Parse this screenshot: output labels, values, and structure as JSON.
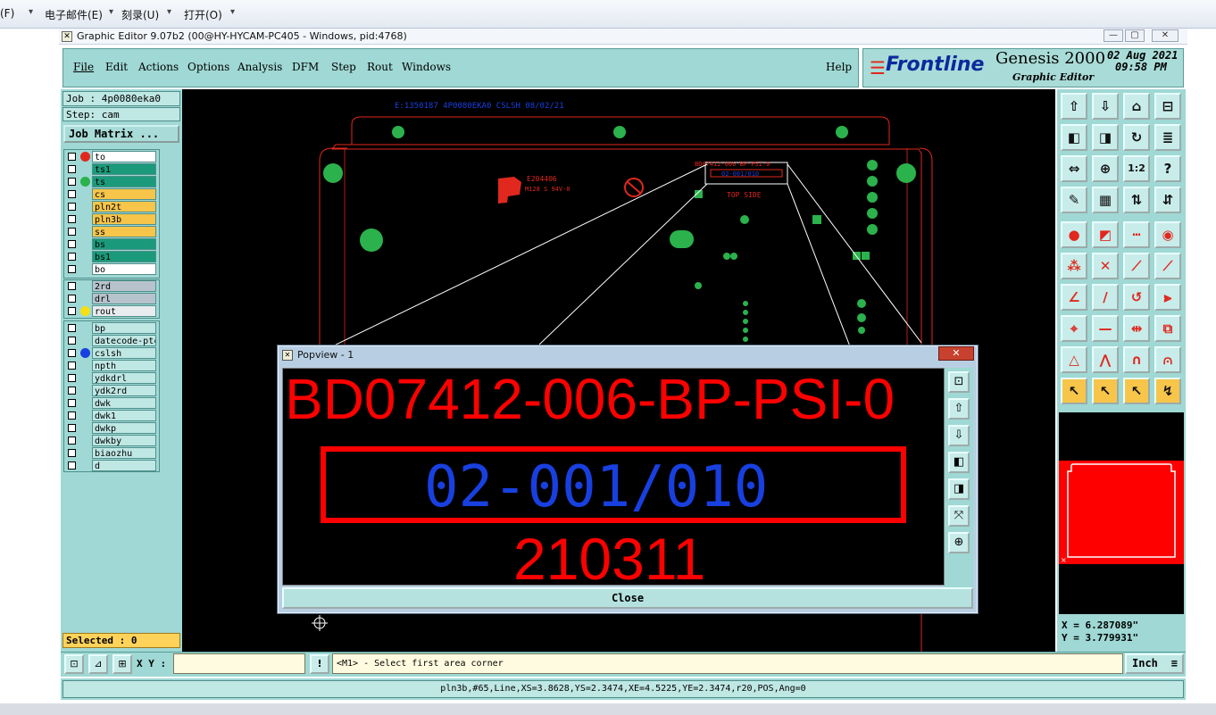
{
  "host_menu": {
    "items": [
      "(F)",
      "电子邮件(E)",
      "刻录(U)",
      "打开(O)"
    ]
  },
  "window": {
    "title": "Graphic Editor 9.07b2 (00@HY-HYCAM-PC405 - Windows, pid:4768)"
  },
  "menubar": {
    "items": [
      "File",
      "Edit",
      "Actions",
      "Options",
      "Analysis",
      "DFM",
      "Step",
      "Rout",
      "Windows"
    ],
    "help": "Help"
  },
  "brand": {
    "frontline": "Frontline",
    "product": "Genesis 2000",
    "subtitle": "Graphic Editor",
    "date": "02 Aug 2021",
    "time": "09:58 PM"
  },
  "left_panel": {
    "job": "Job : 4p0080eka0",
    "step": "Step: cam",
    "job_matrix": "Job Matrix ...",
    "layers_group1": [
      {
        "name": "to",
        "bg": "#ffffff",
        "dot": "#e0281e"
      },
      {
        "name": "ts1",
        "bg": "#1a9a7a",
        "dot": ""
      },
      {
        "name": "ts",
        "bg": "#1a9a7a",
        "dot": "#2bb24c"
      },
      {
        "name": "cs",
        "bg": "#f6c54a",
        "dot": ""
      },
      {
        "name": "pln2t",
        "bg": "#f6c54a",
        "dot": ""
      },
      {
        "name": "pln3b",
        "bg": "#f6c54a",
        "dot": ""
      },
      {
        "name": "ss",
        "bg": "#f6c54a",
        "dot": ""
      },
      {
        "name": "bs",
        "bg": "#1a9a7a",
        "dot": ""
      },
      {
        "name": "bs1",
        "bg": "#1a9a7a",
        "dot": ""
      },
      {
        "name": "bo",
        "bg": "#ffffff",
        "dot": ""
      }
    ],
    "layers_group2": [
      {
        "name": "2rd",
        "bg": "#b7c3cc",
        "dot": ""
      },
      {
        "name": "drl",
        "bg": "#b7c3cc",
        "dot": ""
      },
      {
        "name": "rout",
        "bg": "#e8ecef",
        "dot": "#f5e016"
      }
    ],
    "layers_group3": [
      {
        "name": "bp",
        "bg": "#bfe7e4",
        "dot": ""
      },
      {
        "name": "datecode-ptc",
        "bg": "#bfe7e4",
        "dot": ""
      },
      {
        "name": "cslsh",
        "bg": "#bfe7e4",
        "dot": "#1840e0"
      },
      {
        "name": "npth",
        "bg": "#bfe7e4",
        "dot": ""
      },
      {
        "name": "ydkdrl",
        "bg": "#bfe7e4",
        "dot": ""
      },
      {
        "name": "ydk2rd",
        "bg": "#bfe7e4",
        "dot": ""
      },
      {
        "name": "dwk",
        "bg": "#bfe7e4",
        "dot": ""
      },
      {
        "name": "dwk1",
        "bg": "#bfe7e4",
        "dot": ""
      },
      {
        "name": "dwkp",
        "bg": "#bfe7e4",
        "dot": ""
      },
      {
        "name": "dwkby",
        "bg": "#bfe7e4",
        "dot": ""
      },
      {
        "name": "biaozhu",
        "bg": "#bfe7e4",
        "dot": ""
      },
      {
        "name": "d",
        "bg": "#bfe7e4",
        "dot": ""
      }
    ],
    "selected": "Selected : 0"
  },
  "canvas": {
    "header_text": "E:1350187  4P0080EKA0  CSLSH  08/02/21",
    "logo_text_1": "E204406",
    "logo_text_2": "M128 S 94V-0",
    "board_label": "TOP SIDE",
    "board_code_small": "02-001/010",
    "board_pn_small": "BD07412-006-BP-PSI-0"
  },
  "popview": {
    "title": "Popview - 1",
    "close_x": "✕",
    "line1": "BD07412-006-BP-PSI-0",
    "line2": "02-001/010",
    "line3": "210311",
    "close_button": "Close"
  },
  "right_panel": {
    "coord_x": "X = 6.287089\"",
    "coord_y": "Y = 3.779931\"",
    "scale_button": "1:2"
  },
  "bottom": {
    "xy_label": "X Y :",
    "xy_value": "",
    "prompt": "<M1> - Select first area corner",
    "units": "Inch",
    "status": "pln3b,#65,Line,XS=3.8628,YS=2.3474,XE=4.5225,YE=2.3474,r20,POS,Ang=0"
  },
  "colors": {
    "panel": "#9fd8d4",
    "canvas": "#000000",
    "feature_green": "#2bb24c",
    "feature_red": "#e0281e",
    "feature_blue": "#1840e0"
  }
}
